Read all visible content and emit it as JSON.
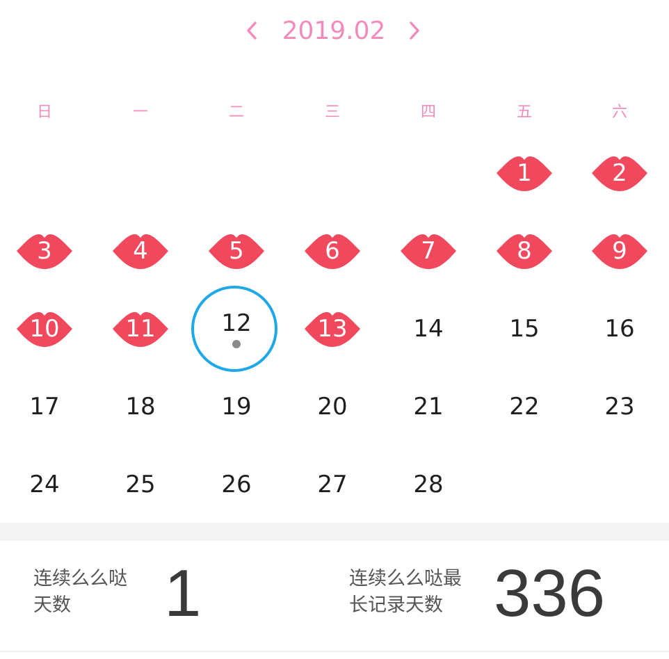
{
  "header": {
    "title": "2019.02",
    "prev_icon": "chevron-left-icon",
    "next_icon": "chevron-right-icon"
  },
  "colors": {
    "accent_pink": "#f28bbc",
    "lips_red": "#f0485d",
    "today_ring_blue": "#1ea8e6"
  },
  "weekdays": [
    "日",
    "一",
    "二",
    "三",
    "四",
    "五",
    "六"
  ],
  "calendar": {
    "weeks": [
      [
        null,
        null,
        null,
        null,
        null,
        {
          "day": "1",
          "kissed": true
        },
        {
          "day": "2",
          "kissed": true
        }
      ],
      [
        {
          "day": "3",
          "kissed": true
        },
        {
          "day": "4",
          "kissed": true
        },
        {
          "day": "5",
          "kissed": true
        },
        {
          "day": "6",
          "kissed": true
        },
        {
          "day": "7",
          "kissed": true
        },
        {
          "day": "8",
          "kissed": true
        },
        {
          "day": "9",
          "kissed": true
        }
      ],
      [
        {
          "day": "10",
          "kissed": true
        },
        {
          "day": "11",
          "kissed": true
        },
        {
          "day": "12",
          "kissed": false,
          "today": true
        },
        {
          "day": "13",
          "kissed": true
        },
        {
          "day": "14",
          "kissed": false
        },
        {
          "day": "15",
          "kissed": false
        },
        {
          "day": "16",
          "kissed": false
        }
      ],
      [
        {
          "day": "17",
          "kissed": false
        },
        {
          "day": "18",
          "kissed": false
        },
        {
          "day": "19",
          "kissed": false
        },
        {
          "day": "20",
          "kissed": false
        },
        {
          "day": "21",
          "kissed": false
        },
        {
          "day": "22",
          "kissed": false
        },
        {
          "day": "23",
          "kissed": false
        }
      ],
      [
        {
          "day": "24",
          "kissed": false
        },
        {
          "day": "25",
          "kissed": false
        },
        {
          "day": "26",
          "kissed": false
        },
        {
          "day": "27",
          "kissed": false
        },
        {
          "day": "28",
          "kissed": false
        },
        null,
        null
      ]
    ]
  },
  "stats": {
    "current_streak": {
      "label_line1": "连续么么哒",
      "label_line2": "天数",
      "value": "1"
    },
    "longest_streak": {
      "label_line1": "连续么么哒最",
      "label_line2": "长记录天数",
      "value": "336"
    }
  }
}
